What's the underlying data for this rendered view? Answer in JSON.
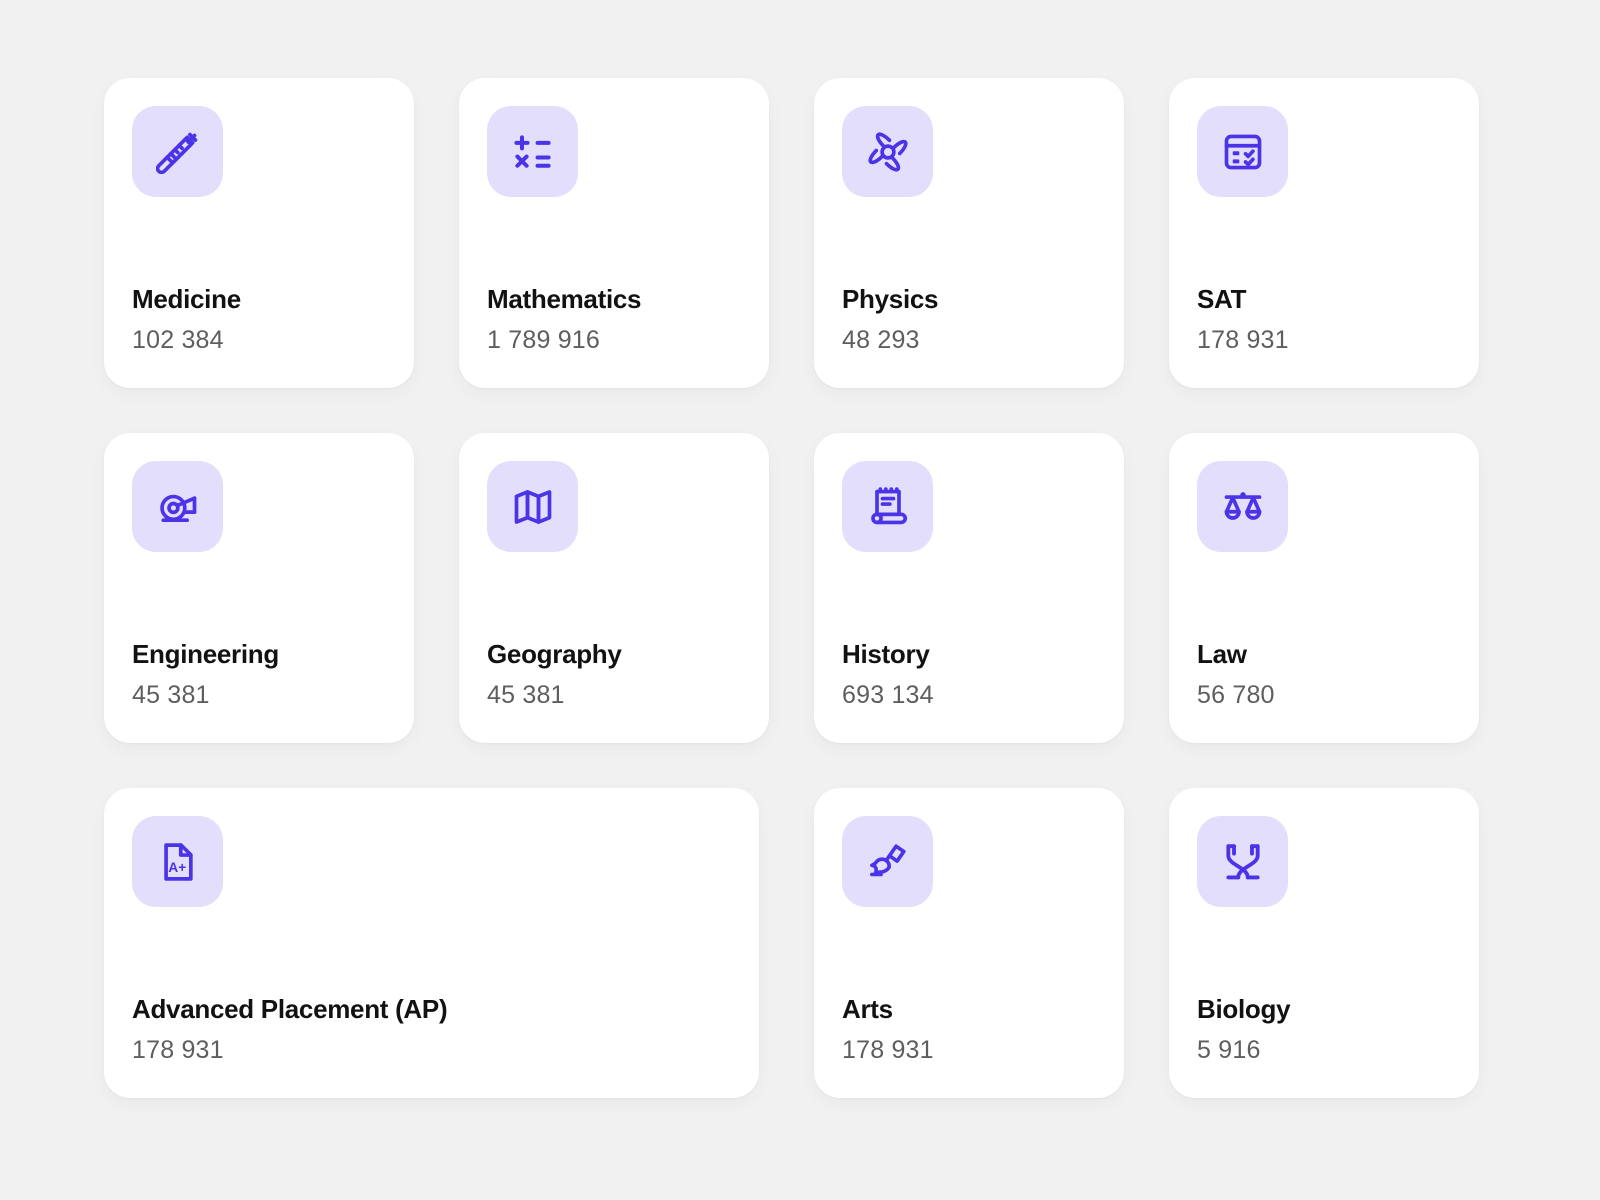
{
  "theme": {
    "page_background": "#f1f1f1",
    "card_background": "#ffffff",
    "icon_background": "#e2defb",
    "icon_accent": "#4b33e8",
    "title_color": "#121212",
    "value_color": "#5e5e5e"
  },
  "cards": [
    {
      "id": "medicine",
      "title": "Medicine",
      "value": "102 384",
      "icon": "syringe-icon",
      "wide": false
    },
    {
      "id": "math",
      "title": "Mathematics",
      "value": "1 789 916",
      "icon": "math-ops-icon",
      "wide": false
    },
    {
      "id": "physics",
      "title": "Physics",
      "value": "48 293",
      "icon": "atom-icon",
      "wide": false
    },
    {
      "id": "sat",
      "title": "SAT",
      "value": "178 931",
      "icon": "test-form-icon",
      "wide": false
    },
    {
      "id": "engineering",
      "title": "Engineering",
      "value": "45 381",
      "icon": "turbine-icon",
      "wide": false
    },
    {
      "id": "geography",
      "title": "Geography",
      "value": "45 381",
      "icon": "map-icon",
      "wide": false
    },
    {
      "id": "history",
      "title": "History",
      "value": "693 134",
      "icon": "scroll-icon",
      "wide": false
    },
    {
      "id": "law",
      "title": "Law",
      "value": "56 780",
      "icon": "scales-icon",
      "wide": false
    },
    {
      "id": "ap",
      "title": "Advanced Placement (AP)",
      "value": "178 931",
      "icon": "grade-doc-icon",
      "wide": true
    },
    {
      "id": "arts",
      "title": "Arts",
      "value": "178 931",
      "icon": "paintbrush-icon",
      "wide": false
    },
    {
      "id": "biology",
      "title": "Biology",
      "value": "5 916",
      "icon": "dna-icon",
      "wide": false
    }
  ]
}
